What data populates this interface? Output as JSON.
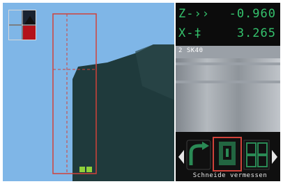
{
  "dro": {
    "z_axis_label": "Z-››",
    "z_value": "-0.960",
    "x_axis_label": "X-‡",
    "x_value": "3.265"
  },
  "tool": {
    "label": "2 SK40"
  },
  "softkeys": {
    "caption": "Schneide vermessen"
  },
  "colors": {
    "viewport_bg": "#7fb6e7",
    "dro_text": "#35c36d",
    "workpiece": "#1f3a3c",
    "tool_outline": "#d0423a",
    "softkey_green": "#2a8a55"
  },
  "icons": [
    "view-thumbnail-icon",
    "left-arrow-softkey-icon",
    "curved-arrow-softkey-icon",
    "measure-tool-softkey-icon",
    "grid-softkey-icon",
    "right-arrow-softkey-icon"
  ]
}
